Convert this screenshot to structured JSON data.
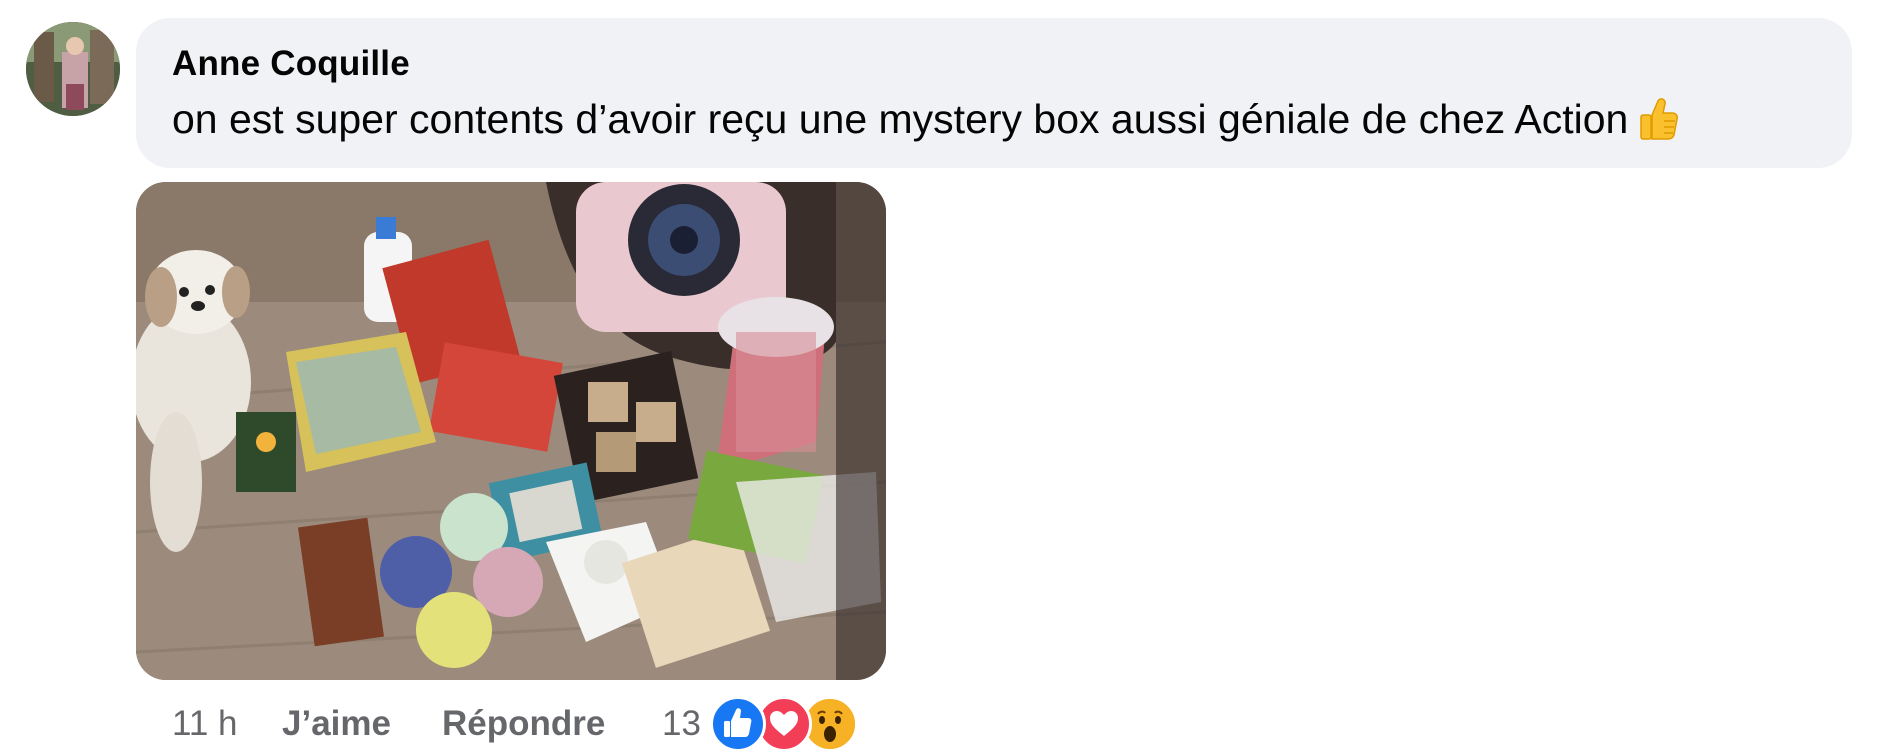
{
  "comment": {
    "author": "Anne Coquille",
    "text": "on est super contents d’avoir reçu une mystery box aussi géniale de chez Action",
    "emoji": "thumbs-up-emoji",
    "image_description_icon": "photo-attachment"
  },
  "actions": {
    "time": "11 h",
    "like_label": "J’aime",
    "reply_label": "Répondre",
    "reaction_count": "13"
  },
  "reactions": [
    "like-reaction-icon",
    "love-reaction-icon",
    "wow-reaction-icon"
  ],
  "colors": {
    "bubble": "#f0f2f5",
    "text": "#050505",
    "meta": "#65676b",
    "like": "#1877f2",
    "love": "#f33e58",
    "wow": "#f7b125"
  }
}
